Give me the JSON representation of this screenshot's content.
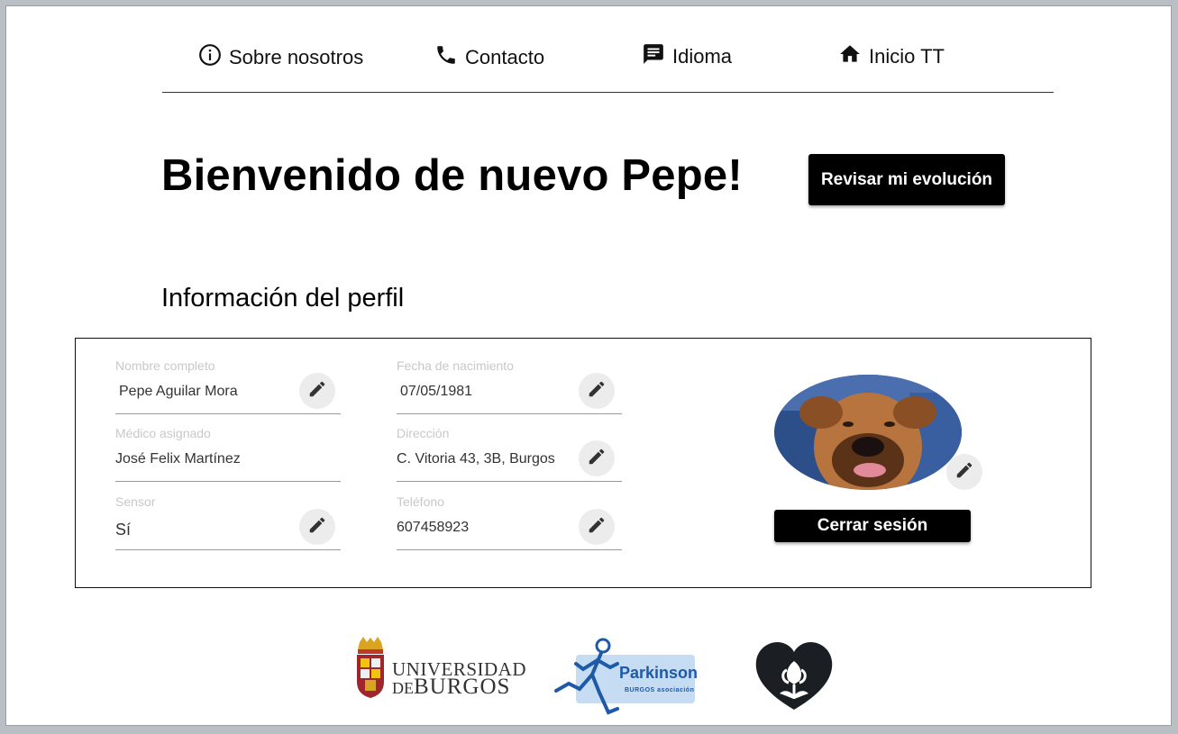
{
  "nav": {
    "about": "Sobre nosotros",
    "contact": "Contacto",
    "language": "Idioma",
    "home": "Inicio TT"
  },
  "welcome": "Bienvenido de nuevo Pepe!",
  "evolution_button": "Revisar mi evolución",
  "profile_title": "Información del perfil",
  "fields": {
    "full_name": {
      "label": "Nombre completo",
      "value": "Pepe Aguilar Mora"
    },
    "birth_date": {
      "label": "Fecha de nacimiento",
      "value": "07/05/1981"
    },
    "doctor": {
      "label": "Médico asignado",
      "value": "José Felix Martínez"
    },
    "address": {
      "label": "Dirección",
      "value": "C. Vitoria 43, 3B, Burgos"
    },
    "sensor": {
      "label": "Sensor",
      "value": "Sí"
    },
    "phone": {
      "label": "Teléfono",
      "value": "607458923"
    }
  },
  "logout_button": "Cerrar sesión",
  "logos": {
    "university_line1": "UNIVERSIDAD",
    "university_line2_prefix": "DE",
    "university_line2": "BURGOS",
    "parkinson_title": "Parkinson",
    "parkinson_sub": "BURGOS asociación"
  },
  "colors": {
    "accent": "#000000",
    "parkinson_blue": "#1e5aa8"
  }
}
